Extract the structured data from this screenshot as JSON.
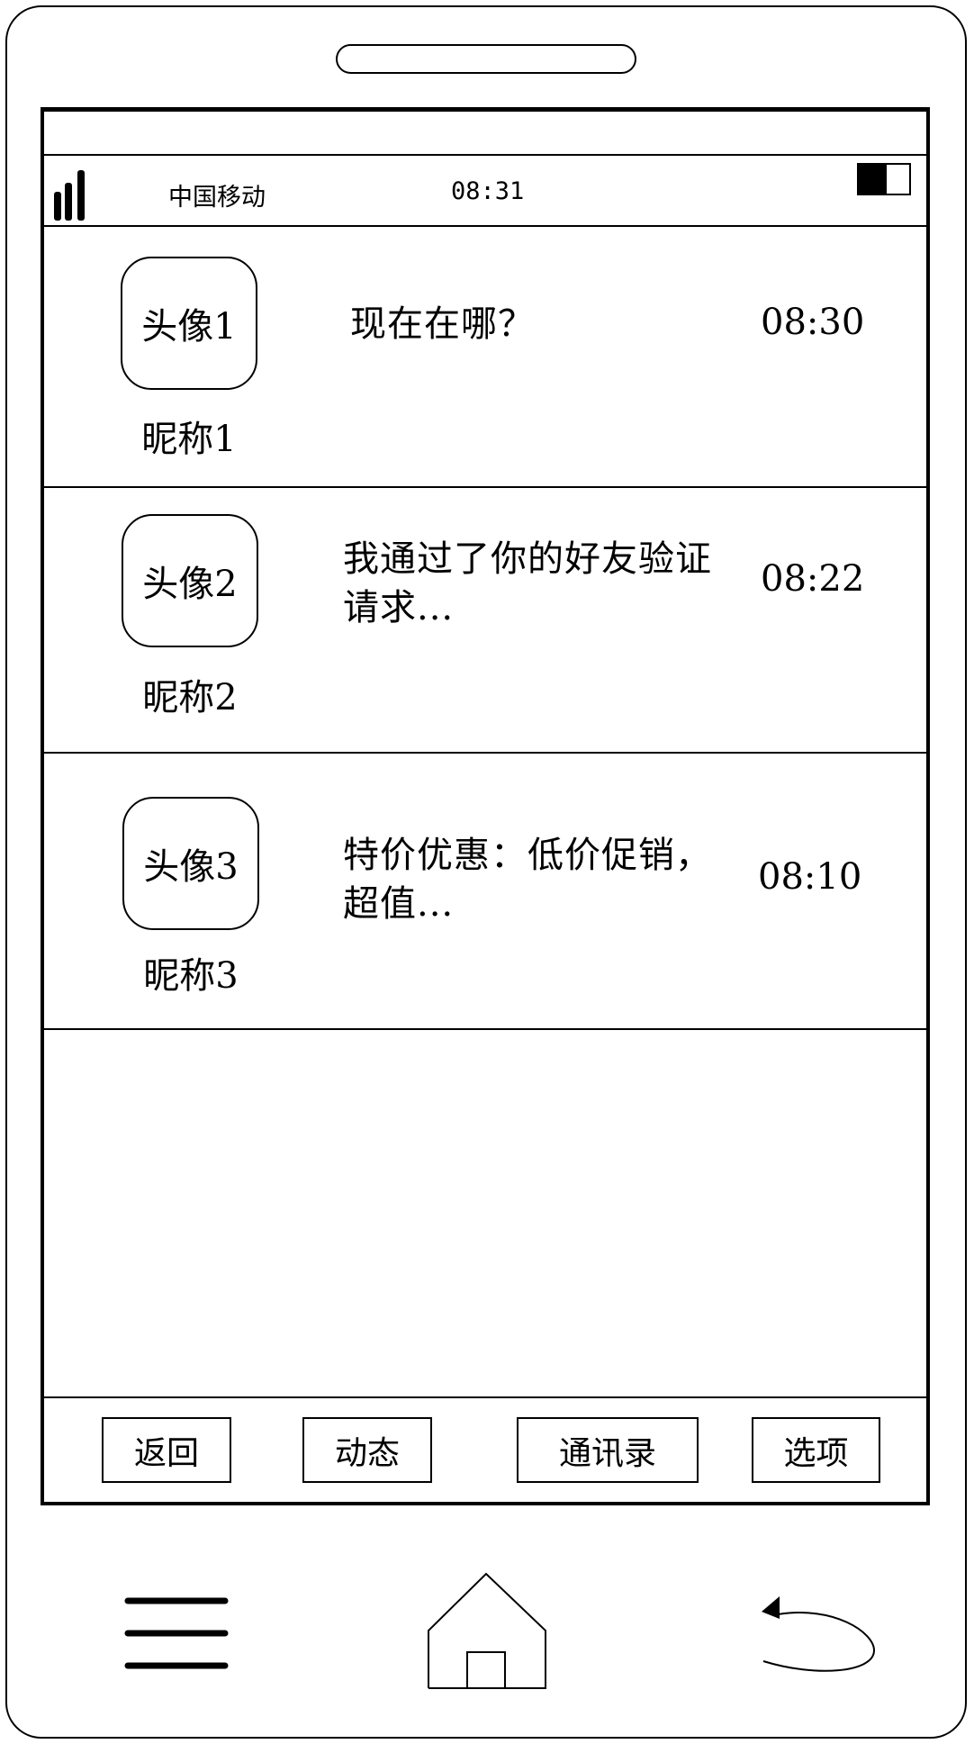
{
  "status_bar": {
    "carrier": "中国移动",
    "time": "08:31",
    "signal_icon": "signal-bars-icon",
    "battery_icon": "battery-icon",
    "battery_level": 0.55
  },
  "conversations": [
    {
      "avatar": "头像1",
      "nickname": "昵称1",
      "message": "现在在哪？",
      "time": "08:30"
    },
    {
      "avatar": "头像2",
      "nickname": "昵称2",
      "message": "我通过了你的好友验证请求...",
      "time": "08:22"
    },
    {
      "avatar": "头像3",
      "nickname": "昵称3",
      "message": "特价优惠：低价促销，超值...",
      "time": "08:10"
    }
  ],
  "bottom_bar": {
    "buttons": [
      {
        "label": "返回"
      },
      {
        "label": "动态"
      },
      {
        "label": "通讯录"
      },
      {
        "label": "选项"
      }
    ]
  },
  "nav_bar": {
    "menu_icon": "menu-icon",
    "home_icon": "home-icon",
    "back_icon": "back-icon"
  }
}
